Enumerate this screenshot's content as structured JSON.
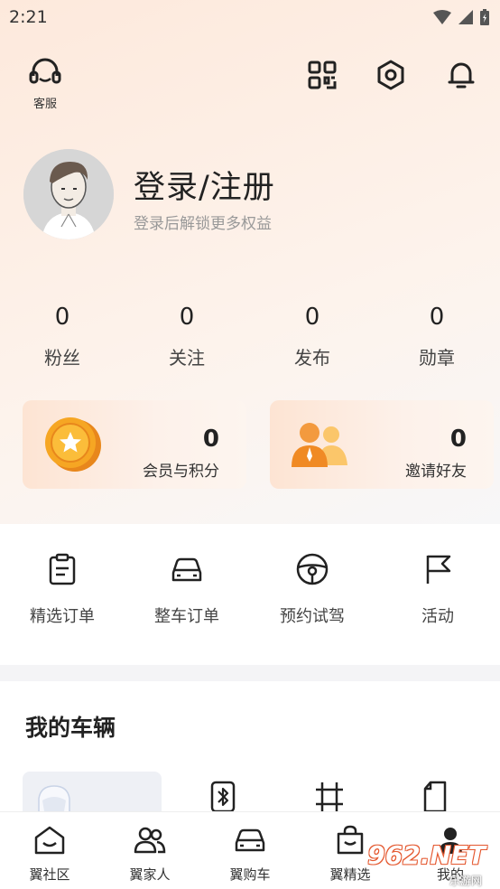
{
  "status_bar": {
    "time": "2:21"
  },
  "header": {
    "service_label": "客服"
  },
  "profile": {
    "title": "登录/注册",
    "subtitle": "登录后解锁更多权益"
  },
  "stats": [
    {
      "value": "0",
      "label": "粉丝"
    },
    {
      "value": "0",
      "label": "关注"
    },
    {
      "value": "0",
      "label": "发布"
    },
    {
      "value": "0",
      "label": "勋章"
    }
  ],
  "cards": [
    {
      "value": "0",
      "label": "会员与积分",
      "icon": "coin-icon"
    },
    {
      "value": "0",
      "label": "邀请好友",
      "icon": "people-icon"
    }
  ],
  "orders": [
    {
      "label": "精选订单",
      "icon": "clipboard-icon"
    },
    {
      "label": "整车订单",
      "icon": "car-icon"
    },
    {
      "label": "预约试驾",
      "icon": "steering-wheel-icon"
    },
    {
      "label": "活动",
      "icon": "flag-icon"
    }
  ],
  "vehicles": {
    "title": "我的车辆"
  },
  "tabs": [
    {
      "label": "翼社区",
      "icon": "home-icon"
    },
    {
      "label": "翼家人",
      "icon": "users-icon"
    },
    {
      "label": "翼购车",
      "icon": "car-icon"
    },
    {
      "label": "翼精选",
      "icon": "shopping-bag-icon"
    },
    {
      "label": "我的",
      "icon": "profile-icon"
    }
  ],
  "watermark": {
    "text": "962.NET",
    "sub": "乐游网"
  },
  "colors": {
    "accent": "#f08a24",
    "text": "#222222",
    "subtext": "#999999"
  }
}
